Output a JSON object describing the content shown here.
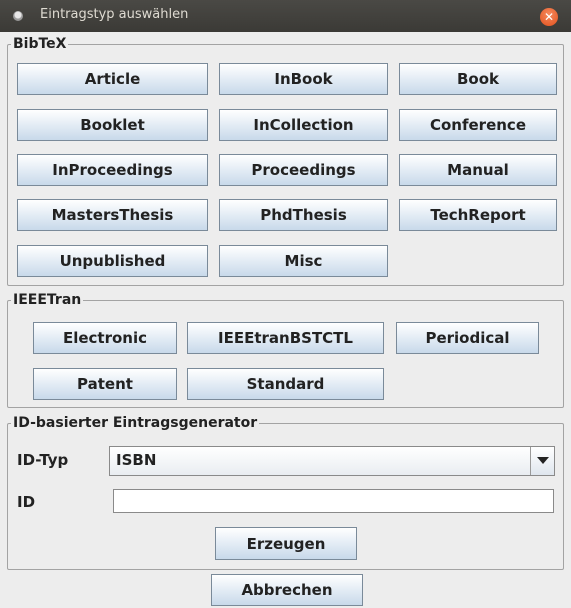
{
  "window": {
    "title": "Eintragstyp auswählen"
  },
  "bibtex": {
    "legend": "BibTeX",
    "buttons": [
      "Article",
      "InBook",
      "Book",
      "Booklet",
      "InCollection",
      "Conference",
      "InProceedings",
      "Proceedings",
      "Manual",
      "MastersThesis",
      "PhdThesis",
      "TechReport",
      "Unpublished",
      "Misc"
    ]
  },
  "ieeetran": {
    "legend": "IEEETran",
    "buttons": [
      "Electronic",
      "IEEEtranBSTCTL",
      "Periodical",
      "Patent",
      "Standard"
    ]
  },
  "generator": {
    "legend": "ID-basierter Eintragsgenerator",
    "id_type_label": "ID-Typ",
    "id_type_value": "ISBN",
    "id_label": "ID",
    "id_value": "",
    "id_placeholder": "",
    "generate_label": "Erzeugen"
  },
  "footer": {
    "cancel_label": "Abbrechen"
  }
}
